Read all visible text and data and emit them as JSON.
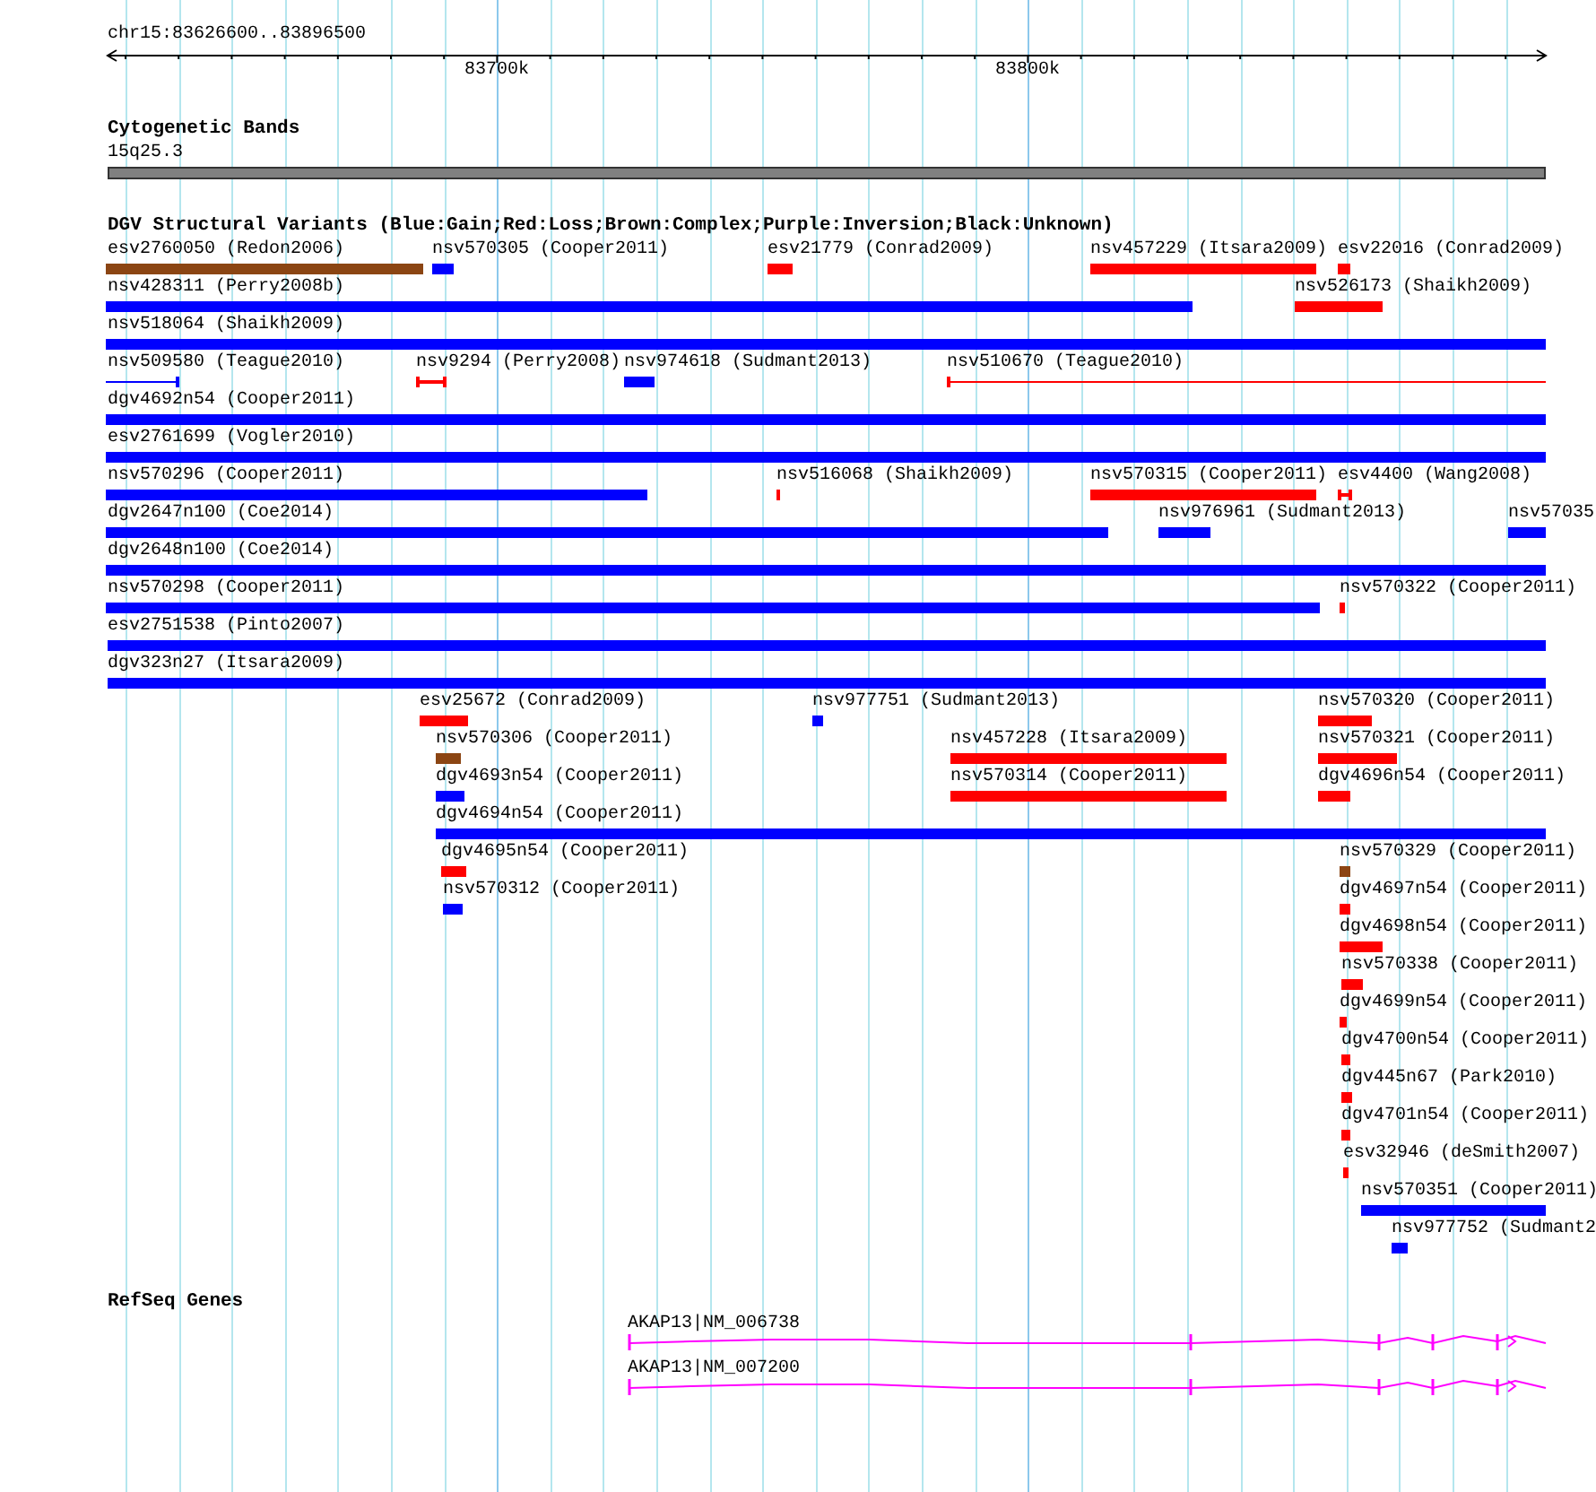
{
  "ruler": {
    "location": "chr15:83626600..83896500",
    "ticks": [
      "83700k",
      "83800k"
    ]
  },
  "cytogenetic_bands": {
    "title": "Cytogenetic Bands",
    "bands": [
      {
        "label": "15q25.3"
      }
    ]
  },
  "dgv_variants": {
    "title": "DGV Structural Variants (Blue:Gain;Red:Loss;Brown:Complex;Purple:Inversion;Black:Unknown)",
    "rows": [
      {
        "features": [
          {
            "label": "esv2760050 (Redon2006)",
            "color": "#8b4513",
            "kind": "bar"
          },
          {
            "label": "nsv570305 (Cooper2011)",
            "color": "#0000ff",
            "kind": "bar"
          },
          {
            "label": "esv21779 (Conrad2009)",
            "color": "#ff0000",
            "kind": "bar"
          },
          {
            "label": "nsv457229 (Itsara2009)",
            "color": "#ff0000",
            "kind": "bar"
          },
          {
            "label": "esv22016 (Conrad2009)",
            "color": "#ff0000",
            "kind": "bar"
          }
        ]
      },
      {
        "features": [
          {
            "label": "nsv428311 (Perry2008b)",
            "color": "#0000ff",
            "kind": "bar"
          },
          {
            "label": "nsv526173 (Shaikh2009)",
            "color": "#ff0000",
            "kind": "bar"
          }
        ]
      },
      {
        "features": [
          {
            "label": "nsv518064 (Shaikh2009)",
            "color": "#0000ff",
            "kind": "bar"
          }
        ]
      },
      {
        "features": [
          {
            "label": "nsv509580 (Teague2010)",
            "color": "#0000ff",
            "kind": "span"
          },
          {
            "label": "nsv9294 (Perry2008)",
            "color": "#ff0000",
            "kind": "span"
          },
          {
            "label": "nsv974618 (Sudmant2013)",
            "color": "#0000ff",
            "kind": "bar"
          },
          {
            "label": "nsv510670 (Teague2010)",
            "color": "#ff0000",
            "kind": "span"
          }
        ]
      },
      {
        "features": [
          {
            "label": "dgv4692n54 (Cooper2011)",
            "color": "#0000ff",
            "kind": "bar"
          }
        ]
      },
      {
        "features": [
          {
            "label": "esv2761699 (Vogler2010)",
            "color": "#0000ff",
            "kind": "bar"
          }
        ]
      },
      {
        "features": [
          {
            "label": "nsv570296 (Cooper2011)",
            "color": "#0000ff",
            "kind": "bar"
          },
          {
            "label": "nsv516068 (Shaikh2009)",
            "color": "#ff0000",
            "kind": "bar"
          },
          {
            "label": "nsv570315 (Cooper2011)",
            "color": "#ff0000",
            "kind": "bar"
          },
          {
            "label": "esv4400 (Wang2008)",
            "color": "#ff0000",
            "kind": "span"
          }
        ]
      },
      {
        "features": [
          {
            "label": "dgv2647n100 (Coe2014)",
            "color": "#0000ff",
            "kind": "bar"
          },
          {
            "label": "nsv976961 (Sudmant2013)",
            "color": "#0000ff",
            "kind": "bar"
          },
          {
            "label": "nsv57035",
            "color": "#0000ff",
            "kind": "bar"
          }
        ]
      },
      {
        "features": [
          {
            "label": "dgv2648n100 (Coe2014)",
            "color": "#0000ff",
            "kind": "bar"
          }
        ]
      },
      {
        "features": [
          {
            "label": "nsv570298 (Cooper2011)",
            "color": "#0000ff",
            "kind": "bar"
          },
          {
            "label": "nsv570322 (Cooper2011)",
            "color": "#ff0000",
            "kind": "bar"
          }
        ]
      },
      {
        "features": [
          {
            "label": "esv2751538 (Pinto2007)",
            "color": "#0000ff",
            "kind": "bar"
          }
        ]
      },
      {
        "features": [
          {
            "label": "dgv323n27 (Itsara2009)",
            "color": "#0000ff",
            "kind": "bar"
          }
        ]
      },
      {
        "features": [
          {
            "label": "esv25672 (Conrad2009)",
            "color": "#ff0000",
            "kind": "bar"
          },
          {
            "label": "nsv977751 (Sudmant2013)",
            "color": "#0000ff",
            "kind": "bar"
          },
          {
            "label": "nsv570320 (Cooper2011)",
            "color": "#ff0000",
            "kind": "bar"
          }
        ]
      },
      {
        "features": [
          {
            "label": "nsv570306 (Cooper2011)",
            "color": "#8b4513",
            "kind": "bar"
          },
          {
            "label": "nsv457228 (Itsara2009)",
            "color": "#ff0000",
            "kind": "bar"
          },
          {
            "label": "nsv570321 (Cooper2011)",
            "color": "#ff0000",
            "kind": "bar"
          }
        ]
      },
      {
        "features": [
          {
            "label": "dgv4693n54 (Cooper2011)",
            "color": "#0000ff",
            "kind": "bar"
          },
          {
            "label": "nsv570314 (Cooper2011)",
            "color": "#ff0000",
            "kind": "bar"
          },
          {
            "label": "dgv4696n54 (Cooper2011)",
            "color": "#ff0000",
            "kind": "bar"
          }
        ]
      },
      {
        "features": [
          {
            "label": "dgv4694n54 (Cooper2011)",
            "color": "#0000ff",
            "kind": "bar"
          }
        ]
      },
      {
        "features": [
          {
            "label": "dgv4695n54 (Cooper2011)",
            "color": "#ff0000",
            "kind": "bar"
          },
          {
            "label": "nsv570329 (Cooper2011)",
            "color": "#8b4513",
            "kind": "bar"
          }
        ]
      },
      {
        "features": [
          {
            "label": "nsv570312 (Cooper2011)",
            "color": "#0000ff",
            "kind": "bar"
          },
          {
            "label": "dgv4697n54 (Cooper2011)",
            "color": "#ff0000",
            "kind": "bar"
          }
        ]
      },
      {
        "features": [
          {
            "label": "dgv4698n54 (Cooper2011)",
            "color": "#ff0000",
            "kind": "bar"
          }
        ]
      },
      {
        "features": [
          {
            "label": "nsv570338 (Cooper2011)",
            "color": "#ff0000",
            "kind": "bar"
          }
        ]
      },
      {
        "features": [
          {
            "label": "dgv4699n54 (Cooper2011)",
            "color": "#ff0000",
            "kind": "bar"
          }
        ]
      },
      {
        "features": [
          {
            "label": "dgv4700n54 (Cooper2011)",
            "color": "#ff0000",
            "kind": "bar"
          }
        ]
      },
      {
        "features": [
          {
            "label": "dgv445n67 (Park2010)",
            "color": "#ff0000",
            "kind": "bar"
          }
        ]
      },
      {
        "features": [
          {
            "label": "dgv4701n54 (Cooper2011)",
            "color": "#ff0000",
            "kind": "bar"
          }
        ]
      },
      {
        "features": [
          {
            "label": "esv32946 (deSmith2007)",
            "color": "#ff0000",
            "kind": "bar"
          }
        ]
      },
      {
        "features": [
          {
            "label": "nsv570351 (Cooper2011)",
            "color": "#0000ff",
            "kind": "bar"
          }
        ]
      },
      {
        "features": [
          {
            "label": "nsv977752 (Sudmant2",
            "color": "#0000ff",
            "kind": "bar"
          }
        ]
      }
    ]
  },
  "refseq_genes": {
    "title": "RefSeq Genes",
    "genes": [
      {
        "label": "AKAP13|NM_006738"
      },
      {
        "label": "AKAP13|NM_007200"
      }
    ]
  }
}
